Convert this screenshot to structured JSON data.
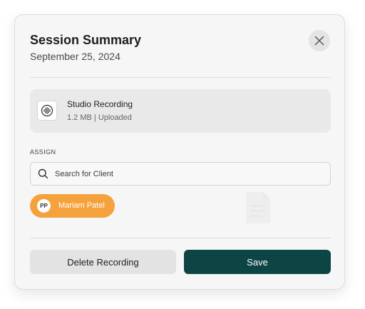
{
  "modal": {
    "title": "Session Summary",
    "date": "September 25, 2024",
    "close_icon": "close-icon"
  },
  "file": {
    "icon": "audio-waveform-icon",
    "name": "Studio Recording",
    "meta": "1.2 MB | Uploaded"
  },
  "assign": {
    "label": "ASSIGN",
    "search_placeholder": "Search for Client",
    "search_value": "",
    "search_icon": "search-icon"
  },
  "client_chip": {
    "initials": "PP",
    "name": "Mariam Patel",
    "color": "#f5a23d"
  },
  "actions": {
    "delete_label": "Delete Recording",
    "save_label": "Save",
    "save_color": "#0d4544"
  }
}
